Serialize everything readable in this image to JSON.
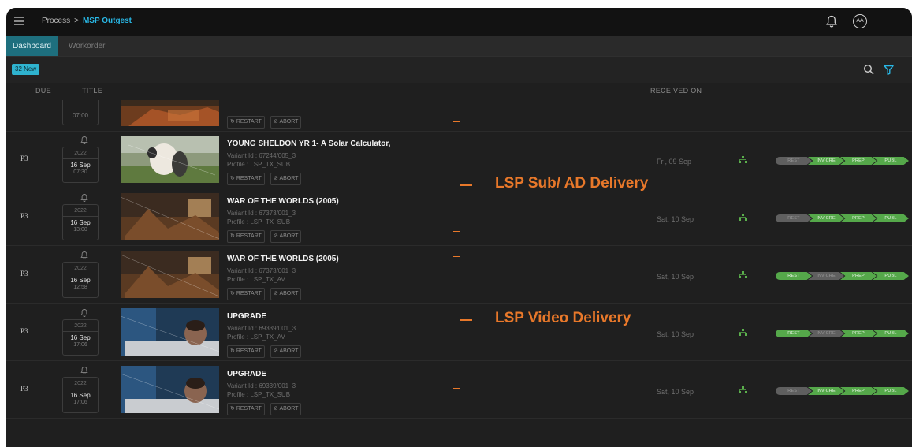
{
  "breadcrumb": {
    "parent": "Process",
    "separator": ">",
    "current": "MSP Outgest"
  },
  "header_icons": {
    "bell": "bell-icon",
    "avatar_initials": "AA"
  },
  "tabs": [
    {
      "label": "Dashboard"
    },
    {
      "label": "Workorder"
    }
  ],
  "toolbar": {
    "new_badge": "32 New",
    "search_icon": "search-icon",
    "filter_icon": "filter-icon"
  },
  "columns": {
    "due": "DUE",
    "title": "TITLE",
    "received_on": "RECEIVED ON"
  },
  "actions": {
    "restart": "RESTART",
    "abort": "ABORT"
  },
  "partial_row": {
    "time": "07:00"
  },
  "stage_labels": [
    "REST",
    "INV-CRE",
    "PREP",
    "PUBL"
  ],
  "colors": {
    "accent": "#29b8e6",
    "stage_done": "#55a84a",
    "stage_pending": "#5f5f5f",
    "annotation": "#e8782a"
  },
  "rows": [
    {
      "priority": "P3",
      "year": "2022",
      "date": "16 Sep",
      "time": "07:30",
      "title": "YOUNG SHELDON YR 1- A Solar Calculator,",
      "variant": "Variant Id : 67244/005_3",
      "profile": "Profile : LSP_TX_SUB",
      "received": "Fri, 09 Sep",
      "stages": [
        "pending",
        "done",
        "done",
        "done"
      ]
    },
    {
      "priority": "P3",
      "year": "2022",
      "date": "16 Sep",
      "time": "13:00",
      "title": "WAR OF THE WORLDS (2005)",
      "variant": "Variant Id : 67373/001_3",
      "profile": "Profile : LSP_TX_SUB",
      "received": "Sat, 10 Sep",
      "stages": [
        "pending",
        "done",
        "done",
        "done"
      ]
    },
    {
      "priority": "P3",
      "year": "2022",
      "date": "16 Sep",
      "time": "12:58",
      "title": "WAR OF THE WORLDS (2005)",
      "variant": "Variant Id : 67373/001_3",
      "profile": "Profile : LSP_TX_AV",
      "received": "Sat, 10 Sep",
      "stages": [
        "done",
        "pending",
        "done",
        "done"
      ]
    },
    {
      "priority": "P3",
      "year": "2022",
      "date": "16 Sep",
      "time": "17:06",
      "title": "UPGRADE",
      "variant": "Variant Id : 69339/001_3",
      "profile": "Profile : LSP_TX_AV",
      "received": "Sat, 10 Sep",
      "stages": [
        "done",
        "pending",
        "done",
        "done"
      ]
    },
    {
      "priority": "P3",
      "year": "2022",
      "date": "16 Sep",
      "time": "17:06",
      "title": "UPGRADE",
      "variant": "Variant Id : 69339/001_3",
      "profile": "Profile : LSP_TX_SUB",
      "received": "Sat, 10 Sep",
      "stages": [
        "pending",
        "done",
        "done",
        "done"
      ]
    }
  ],
  "annotations": {
    "sub_ad": "LSP Sub/ AD Delivery",
    "video": "LSP Video Delivery"
  }
}
